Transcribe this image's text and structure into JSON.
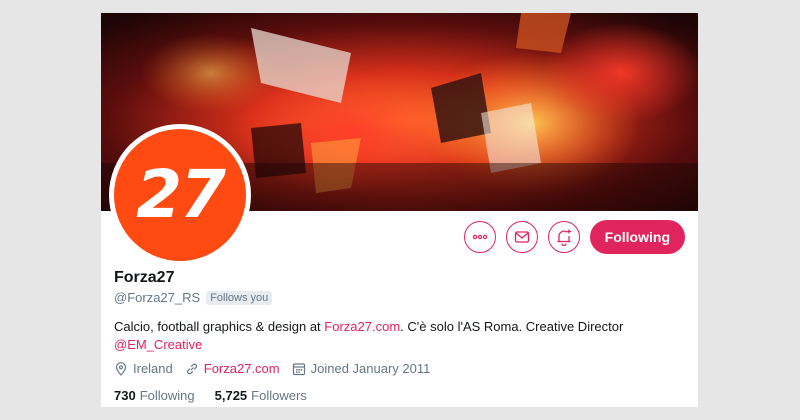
{
  "profile": {
    "name": "Forza27",
    "handle": "@Forza27_RS",
    "follows_you": "Follows you",
    "avatar_text": "27",
    "bio_text1": "Calcio, football graphics & design at ",
    "bio_link1": "Forza27.com",
    "bio_text2": ". C'è solo l'AS Roma. Creative Director",
    "bio_mention": "@EM_Creative",
    "location": "Ireland",
    "website": "Forza27.com",
    "joined": "Joined January 2011",
    "following_count": "730",
    "following_label": "Following",
    "followers_count": "5,725",
    "followers_label": "Followers"
  },
  "actions": {
    "more_icon": "more-icon",
    "message_icon": "envelope-icon",
    "notify_icon": "bell-plus-icon",
    "follow_label": "Following"
  },
  "colors": {
    "accent": "#e0245e",
    "avatar_bg": "#ff4a11",
    "muted": "#657786",
    "text": "#14171a"
  }
}
